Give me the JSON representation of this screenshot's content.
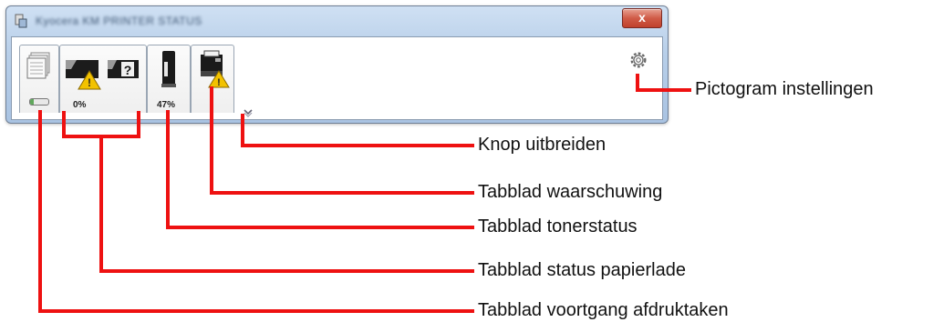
{
  "window": {
    "title": "Kyocera KM PRINTER STATUS",
    "close_symbol": "x",
    "accent": "#cfe0f3",
    "close_color": "#c0412c"
  },
  "tabs": {
    "print_progress": {
      "icon": "print-job-icon",
      "progress": 0.2
    },
    "paper_tray": {
      "value": "0%",
      "icons": [
        "paper-tray-warning-icon",
        "paper-tray-unknown-icon"
      ]
    },
    "toner": {
      "value": "47%",
      "icon": "toner-icon"
    },
    "warning": {
      "icon": "printer-warning-icon"
    }
  },
  "controls": {
    "settings_icon": "gear-icon",
    "expand_icon": "chevron-down-icon"
  },
  "callouts": {
    "settings": "Pictogram instellingen",
    "expand": "Knop uitbreiden",
    "warning": "Tabblad waarschuwing",
    "toner": "Tabblad tonerstatus",
    "paper": "Tabblad status papierlade",
    "progress": "Tabblad voortgang afdruktaken"
  },
  "colors": {
    "callout_line": "#ee1111",
    "warning": "#f2c200"
  }
}
